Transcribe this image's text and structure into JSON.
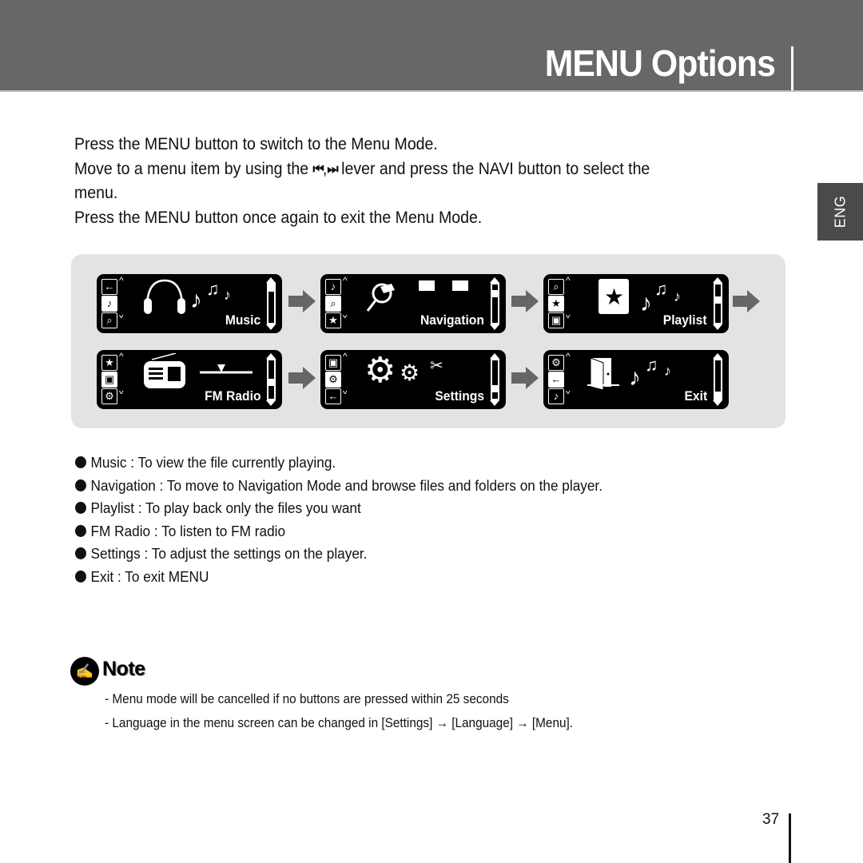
{
  "header": {
    "title": "MENU Options"
  },
  "language_tab": "ENG",
  "intro": {
    "line1": "Press the MENU button to switch to the Menu Mode.",
    "line2_before": "Move to a menu item by using the",
    "prev_icon": "⏮",
    "separator": ",",
    "next_icon": "⏭",
    "line2_after": "lever and press the NAVI button to select the menu.",
    "line3": "Press the MENU button once again to exit the Menu Mode."
  },
  "menu_screens": [
    {
      "label": "Music",
      "side_icons": [
        "←",
        "♪",
        "⌕"
      ],
      "scroll_position": 0.0,
      "art": "headphones-music-icon"
    },
    {
      "label": "Navigation",
      "side_icons": [
        "♪",
        "⌕",
        "★"
      ],
      "scroll_position": 0.17,
      "art": "folder-search-icon"
    },
    {
      "label": "Playlist",
      "side_icons": [
        "⌕",
        "★",
        "▣"
      ],
      "scroll_position": 0.38,
      "art": "playlist-star-icon"
    },
    {
      "label": "FM Radio",
      "side_icons": [
        "★",
        "▣",
        "⚙"
      ],
      "scroll_position": 0.6,
      "art": "radio-icon"
    },
    {
      "label": "Settings",
      "side_icons": [
        "▣",
        "⚙",
        "←"
      ],
      "scroll_position": 0.8,
      "art": "gears-icon"
    },
    {
      "label": "Exit",
      "side_icons": [
        "⚙",
        "←",
        "♪"
      ],
      "scroll_position": 1.0,
      "art": "door-exit-icon"
    }
  ],
  "descriptions": [
    "Music : To view the file currently playing.",
    "Navigation : To move to Navigation Mode and browse files and folders on the player.",
    "Playlist : To play back only the files you want",
    "FM Radio : To listen to FM radio",
    "Settings : To adjust the settings on the player.",
    "Exit : To exit MENU"
  ],
  "note": {
    "title": "Note",
    "icon": "✍",
    "lines": [
      "- Menu mode will be cancelled if no buttons are pressed within 25 seconds",
      "- Language in the menu screen can be changed in [Settings] →  [Language] → [Menu]."
    ]
  },
  "page_number": "37"
}
